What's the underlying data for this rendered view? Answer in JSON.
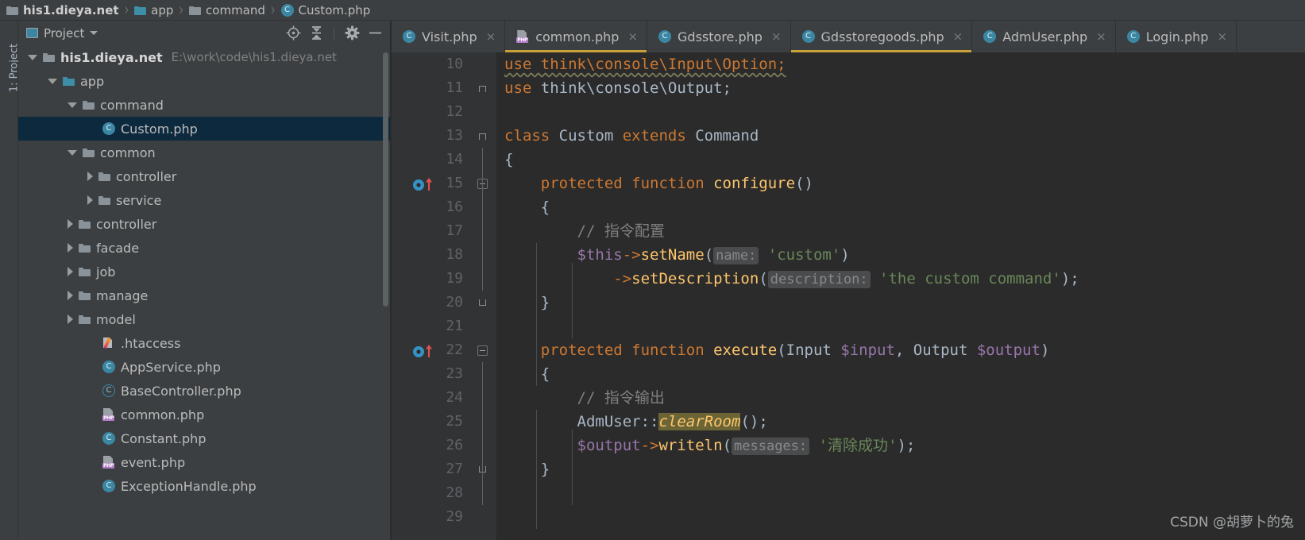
{
  "breadcrumb": {
    "name": "breadcrumb",
    "separator": "›",
    "items": [
      {
        "label": "his1.dieya.net",
        "icon": "folder-icon",
        "bold": true,
        "accent": false
      },
      {
        "label": "app",
        "icon": "folder-icon",
        "bold": false,
        "accent": true
      },
      {
        "label": "command",
        "icon": "folder-icon",
        "bold": false,
        "accent": false
      },
      {
        "label": "Custom.php",
        "icon": "php-class-icon",
        "bold": false,
        "accent": false
      }
    ]
  },
  "tool_strip": {
    "vertical_label": "1: Project"
  },
  "project_panel": {
    "title": "Project",
    "toolbar": {
      "window_icon": "project-window-icon",
      "dropdown_icon": "chevron-down-icon",
      "locate_icon": "select-opened-file-icon",
      "collapse_icon": "collapse-all-icon",
      "settings_icon": "gear-icon",
      "hide_icon": "minimize-icon"
    },
    "tree": [
      {
        "label": "his1.dieya.net",
        "sub": "E:\\work\\code\\his1.dieya.net",
        "icon": "folder-icon",
        "indent": 0,
        "twisty": "open",
        "bold": true,
        "selected": false,
        "accent": false
      },
      {
        "label": "app",
        "sub": "",
        "icon": "folder-icon",
        "indent": 1,
        "twisty": "open",
        "bold": false,
        "selected": false,
        "accent": true
      },
      {
        "label": "command",
        "sub": "",
        "icon": "folder-icon",
        "indent": 2,
        "twisty": "open",
        "bold": false,
        "selected": false,
        "accent": false
      },
      {
        "label": "Custom.php",
        "sub": "",
        "icon": "php-class-icon",
        "indent": 3,
        "twisty": "none",
        "bold": false,
        "selected": true,
        "accent": false
      },
      {
        "label": "common",
        "sub": "",
        "icon": "folder-icon",
        "indent": 2,
        "twisty": "open",
        "bold": false,
        "selected": false,
        "accent": false
      },
      {
        "label": "controller",
        "sub": "",
        "icon": "folder-icon",
        "indent": 3,
        "twisty": "closed",
        "bold": false,
        "selected": false,
        "accent": false
      },
      {
        "label": "service",
        "sub": "",
        "icon": "folder-icon",
        "indent": 3,
        "twisty": "closed",
        "bold": false,
        "selected": false,
        "accent": false
      },
      {
        "label": "controller",
        "sub": "",
        "icon": "folder-icon",
        "indent": 2,
        "twisty": "closed",
        "bold": false,
        "selected": false,
        "accent": false
      },
      {
        "label": "facade",
        "sub": "",
        "icon": "folder-icon",
        "indent": 2,
        "twisty": "closed",
        "bold": false,
        "selected": false,
        "accent": false
      },
      {
        "label": "job",
        "sub": "",
        "icon": "folder-icon",
        "indent": 2,
        "twisty": "closed",
        "bold": false,
        "selected": false,
        "accent": false
      },
      {
        "label": "manage",
        "sub": "",
        "icon": "folder-icon",
        "indent": 2,
        "twisty": "closed",
        "bold": false,
        "selected": false,
        "accent": false
      },
      {
        "label": "model",
        "sub": "",
        "icon": "folder-icon",
        "indent": 2,
        "twisty": "closed",
        "bold": false,
        "selected": false,
        "accent": false
      },
      {
        "label": ".htaccess",
        "sub": "",
        "icon": "htaccess-icon",
        "indent": 3,
        "twisty": "none",
        "bold": false,
        "selected": false,
        "accent": false
      },
      {
        "label": "AppService.php",
        "sub": "",
        "icon": "php-class-icon",
        "indent": 3,
        "twisty": "none",
        "bold": false,
        "selected": false,
        "accent": false
      },
      {
        "label": "BaseController.php",
        "sub": "",
        "icon": "php-abstract-class-icon",
        "indent": 3,
        "twisty": "none",
        "bold": false,
        "selected": false,
        "accent": false
      },
      {
        "label": "common.php",
        "sub": "",
        "icon": "php-file-icon",
        "indent": 3,
        "twisty": "none",
        "bold": false,
        "selected": false,
        "accent": false
      },
      {
        "label": "Constant.php",
        "sub": "",
        "icon": "php-class-icon",
        "indent": 3,
        "twisty": "none",
        "bold": false,
        "selected": false,
        "accent": false
      },
      {
        "label": "event.php",
        "sub": "",
        "icon": "php-file-icon",
        "indent": 3,
        "twisty": "none",
        "bold": false,
        "selected": false,
        "accent": false
      },
      {
        "label": "ExceptionHandle.php",
        "sub": "",
        "icon": "php-class-icon",
        "indent": 3,
        "twisty": "none",
        "bold": false,
        "selected": false,
        "accent": false
      }
    ]
  },
  "editor": {
    "tabs": [
      {
        "label": "Visit.php",
        "icon": "php-class-icon",
        "close": "×",
        "active": false,
        "modified": false
      },
      {
        "label": "common.php",
        "icon": "php-file-icon",
        "close": "×",
        "active": false,
        "modified": true
      },
      {
        "label": "Gdsstore.php",
        "icon": "php-class-icon",
        "close": "×",
        "active": false,
        "modified": false
      },
      {
        "label": "Gdsstoregoods.php",
        "icon": "php-class-icon",
        "close": "×",
        "active": false,
        "modified": true
      },
      {
        "label": "AdmUser.php",
        "icon": "php-class-icon",
        "close": "×",
        "active": false,
        "modified": false
      },
      {
        "label": "Login.php",
        "icon": "php-class-icon",
        "close": "×",
        "active": false,
        "modified": false
      }
    ],
    "lines": [
      {
        "num": "10",
        "fold": "none",
        "marker": false
      },
      {
        "num": "11",
        "fold": "bracket-top",
        "marker": false
      },
      {
        "num": "12",
        "fold": "none",
        "marker": false
      },
      {
        "num": "13",
        "fold": "bracket-top",
        "marker": false
      },
      {
        "num": "14",
        "fold": "none",
        "marker": false
      },
      {
        "num": "15",
        "fold": "minus",
        "marker": true
      },
      {
        "num": "16",
        "fold": "none",
        "marker": false
      },
      {
        "num": "17",
        "fold": "none",
        "marker": false
      },
      {
        "num": "18",
        "fold": "none",
        "marker": false
      },
      {
        "num": "19",
        "fold": "none",
        "marker": false
      },
      {
        "num": "20",
        "fold": "bracket-bot",
        "marker": false
      },
      {
        "num": "21",
        "fold": "none",
        "marker": false
      },
      {
        "num": "22",
        "fold": "minus",
        "marker": true
      },
      {
        "num": "23",
        "fold": "none",
        "marker": false
      },
      {
        "num": "24",
        "fold": "none",
        "marker": false
      },
      {
        "num": "25",
        "fold": "none",
        "marker": false
      },
      {
        "num": "26",
        "fold": "none",
        "marker": false
      },
      {
        "num": "27",
        "fold": "bracket-bot",
        "marker": false
      },
      {
        "num": "28",
        "fold": "none",
        "marker": false
      },
      {
        "num": "29",
        "fold": "none",
        "marker": false
      }
    ],
    "code": {
      "l10_partial": "use think\\console\\Input\\Option;",
      "l11_kw": "use",
      "l11_rest": " think\\console\\Output",
      "l11_semi": ";",
      "l13_class": "class",
      "l13_name": " Custom ",
      "l13_extends": "extends",
      "l13_base": " Command",
      "l14_brace": "{",
      "l15_mod": "    protected function ",
      "l15_fn": "configure",
      "l15_paren": "()",
      "l16_brace": "    {",
      "l17_comment": "        // 指令配置",
      "l18_var": "        $this",
      "l18_arrow": "->",
      "l18_fn": "setName",
      "l18_open": "(",
      "l18_hint": "name:",
      "l18_str": "'custom'",
      "l18_close": ")",
      "l19_arrow": "            ->",
      "l19_fn": "setDescription",
      "l19_open": "(",
      "l19_hint": "description:",
      "l19_str": "'the custom command'",
      "l19_close": ");",
      "l20_brace": "    }",
      "l22_mod": "    protected function ",
      "l22_fn": "execute",
      "l22_p1": "(Input ",
      "l22_v1": "$input",
      "l22_p2": ", Output ",
      "l22_v2": "$output",
      "l22_p3": ")",
      "l23_brace": "    {",
      "l24_comment": "        // 指令输出",
      "l25_cls": "        AdmUser",
      "l25_op": "::",
      "l25_fn": "clearRoom",
      "l25_rest": "();",
      "l26_var": "        $output",
      "l26_arrow": "->",
      "l26_fn": "writeln",
      "l26_open": "(",
      "l26_hint": "messages:",
      "l26_str": "'清除成功'",
      "l26_close": ");",
      "l27_brace": "    }"
    }
  },
  "watermark": "CSDN @胡萝卜的兔",
  "colors": {
    "accent_teal": "#3b87a3",
    "keyword_orange": "#cc7832",
    "function_gold": "#ffc66d",
    "string_green": "#6a8759",
    "variable_purple": "#9876aa",
    "comment_gray": "#808080",
    "selection_blue": "#0d293e",
    "editor_bg": "#2b2b2b",
    "panel_bg": "#3c3f41"
  }
}
